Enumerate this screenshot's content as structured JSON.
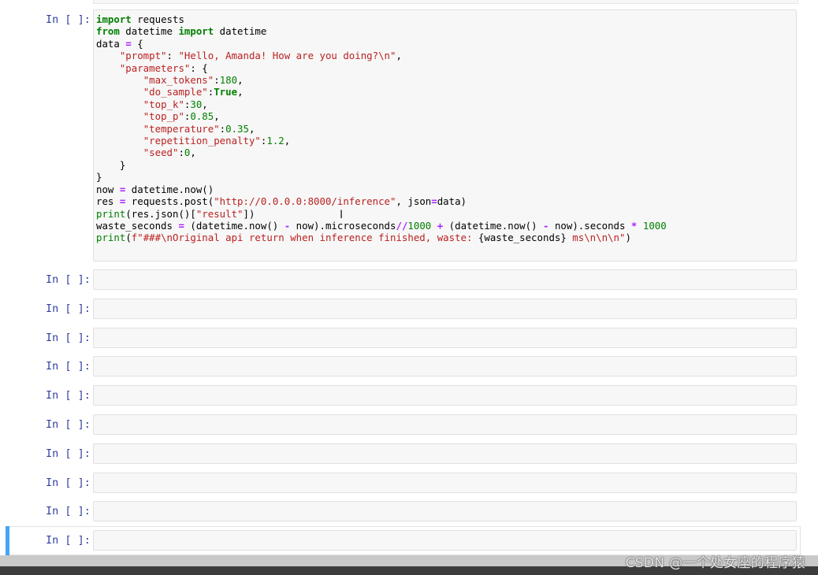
{
  "notebook": {
    "prompt_label": "In [ ]:",
    "code_cell": {
      "lines": [
        [
          [
            "kw",
            "import"
          ],
          [
            "t",
            " requests"
          ]
        ],
        [
          [
            "kw",
            "from"
          ],
          [
            "t",
            " datetime "
          ],
          [
            "kw",
            "import"
          ],
          [
            "t",
            " datetime"
          ]
        ],
        [
          [
            "t",
            "data "
          ],
          [
            "op",
            "="
          ],
          [
            "t",
            " {"
          ]
        ],
        [
          [
            "t",
            "    "
          ],
          [
            "str",
            "\"prompt\""
          ],
          [
            "t",
            ": "
          ],
          [
            "str",
            "\"Hello, Amanda! How are you doing?\\n\""
          ],
          [
            "t",
            ","
          ]
        ],
        [
          [
            "t",
            "    "
          ],
          [
            "str",
            "\"parameters\""
          ],
          [
            "t",
            ": {"
          ]
        ],
        [
          [
            "t",
            "        "
          ],
          [
            "str",
            "\"max_tokens\""
          ],
          [
            "t",
            ":"
          ],
          [
            "num",
            "180"
          ],
          [
            "t",
            ","
          ]
        ],
        [
          [
            "t",
            "        "
          ],
          [
            "str",
            "\"do_sample\""
          ],
          [
            "t",
            ":"
          ],
          [
            "kw",
            "True"
          ],
          [
            "t",
            ","
          ]
        ],
        [
          [
            "t",
            "        "
          ],
          [
            "str",
            "\"top_k\""
          ],
          [
            "t",
            ":"
          ],
          [
            "num",
            "30"
          ],
          [
            "t",
            ","
          ]
        ],
        [
          [
            "t",
            "        "
          ],
          [
            "str",
            "\"top_p\""
          ],
          [
            "t",
            ":"
          ],
          [
            "num",
            "0.85"
          ],
          [
            "t",
            ","
          ]
        ],
        [
          [
            "t",
            "        "
          ],
          [
            "str",
            "\"temperature\""
          ],
          [
            "t",
            ":"
          ],
          [
            "num",
            "0.35"
          ],
          [
            "t",
            ","
          ]
        ],
        [
          [
            "t",
            "        "
          ],
          [
            "str",
            "\"repetition_penalty\""
          ],
          [
            "t",
            ":"
          ],
          [
            "num",
            "1.2"
          ],
          [
            "t",
            ","
          ]
        ],
        [
          [
            "t",
            "        "
          ],
          [
            "str",
            "\"seed\""
          ],
          [
            "t",
            ":"
          ],
          [
            "num",
            "0"
          ],
          [
            "t",
            ","
          ]
        ],
        [
          [
            "t",
            "    }"
          ]
        ],
        [
          [
            "t",
            "}"
          ]
        ],
        [
          [
            "t",
            "now "
          ],
          [
            "op",
            "="
          ],
          [
            "t",
            " datetime.now()"
          ]
        ],
        [
          [
            "t",
            "res "
          ],
          [
            "op",
            "="
          ],
          [
            "t",
            " requests.post("
          ],
          [
            "str",
            "\"http://0.0.0.0:8000/inference\""
          ],
          [
            "t",
            ", json"
          ],
          [
            "op",
            "="
          ],
          [
            "t",
            "data)"
          ]
        ],
        [
          [
            "fn",
            "print"
          ],
          [
            "t",
            "(res.json()["
          ],
          [
            "str",
            "\"result\""
          ],
          [
            "t",
            "])"
          ]
        ],
        [
          [
            "t",
            "waste_seconds "
          ],
          [
            "op",
            "="
          ],
          [
            "t",
            " (datetime.now() "
          ],
          [
            "op",
            "-"
          ],
          [
            "t",
            " now).microseconds"
          ],
          [
            "op",
            "//"
          ],
          [
            "num",
            "1000"
          ],
          [
            "t",
            " "
          ],
          [
            "op",
            "+"
          ],
          [
            "t",
            " (datetime.now() "
          ],
          [
            "op",
            "-"
          ],
          [
            "t",
            " now).seconds "
          ],
          [
            "op",
            "*"
          ],
          [
            "t",
            " "
          ],
          [
            "num",
            "1000"
          ]
        ],
        [
          [
            "fn",
            "print"
          ],
          [
            "t",
            "("
          ],
          [
            "str",
            "f\"###\\nOriginal api return when inference finished, waste: "
          ],
          [
            "t",
            "{waste_seconds}"
          ],
          [
            "str",
            " ms\\n\\n\\n\""
          ],
          [
            "t",
            ")"
          ]
        ]
      ]
    },
    "empty_cell_count": 10
  },
  "watermark": "CSDN @一个处女座的程序猿",
  "colors": {
    "keyword": "#008000",
    "operator": "#aa22ff",
    "string": "#ba2121",
    "prompt": "#303f9f",
    "selected_cell_bar": "#42a5f5"
  }
}
